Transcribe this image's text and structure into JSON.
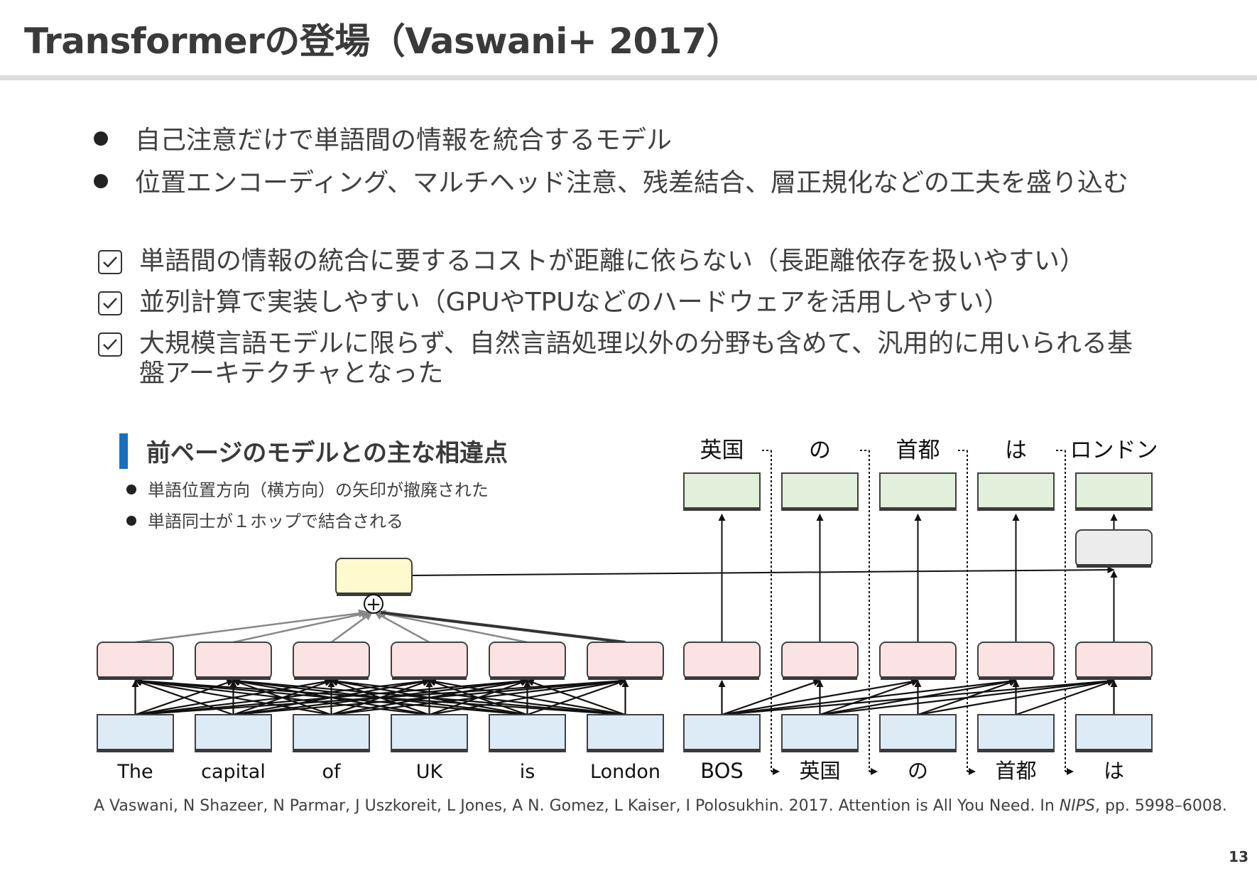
{
  "title": "Transformerの登場（Vaswani+ 2017）",
  "bullets": [
    "自己注意だけで単語間の情報を統合するモデル",
    "位置エンコーディング、マルチヘッド注意、残差結合、層正規化などの工夫を盛り込む"
  ],
  "checks": [
    {
      "line1": "単語間の情報の統合に要するコストが距離に依らない（長距離依存を扱いやすい）",
      "line2": ""
    },
    {
      "line1": "並列計算で実装しやすい（GPUやTPUなどのハードウェアを活用しやすい）",
      "line2": ""
    },
    {
      "line1": "大規模言語モデルに限らず、自然言語処理以外の分野も含めて、汎用的に用いられる基",
      "line2": "盤アーキテクチャとなった"
    }
  ],
  "section": {
    "title": "前ページのモデルとの主な相違点",
    "items": [
      "単語位置方向（横方向）の矢印が撤廃された",
      "単語同士が１ホップで結合される"
    ]
  },
  "diagram": {
    "encoder_words": [
      "The",
      "capital",
      "of",
      "UK",
      "is",
      "London"
    ],
    "decoder_inputs": [
      "BOS",
      "英国",
      "の",
      "首都",
      "は"
    ],
    "decoder_outputs": [
      "英国",
      "の",
      "首都",
      "は",
      "ロンドン"
    ],
    "sum_symbol": "+",
    "colors": {
      "input_box": "#ddebf7",
      "hidden_box": "#fbe3e3",
      "output_box": "#e2efda",
      "context_box": "#fffacd",
      "attention_box": "#ececec",
      "box_border": "#404040"
    }
  },
  "citation": {
    "before": "A Vaswani, N Shazeer, N Parmar, J Uszkoreit, L Jones, A N. Gomez, L Kaiser, I Polosukhin. 2017. Attention is All You Need. In ",
    "venue": "NIPS",
    "after": ", pp. 5998–6008."
  },
  "page_number": "13"
}
